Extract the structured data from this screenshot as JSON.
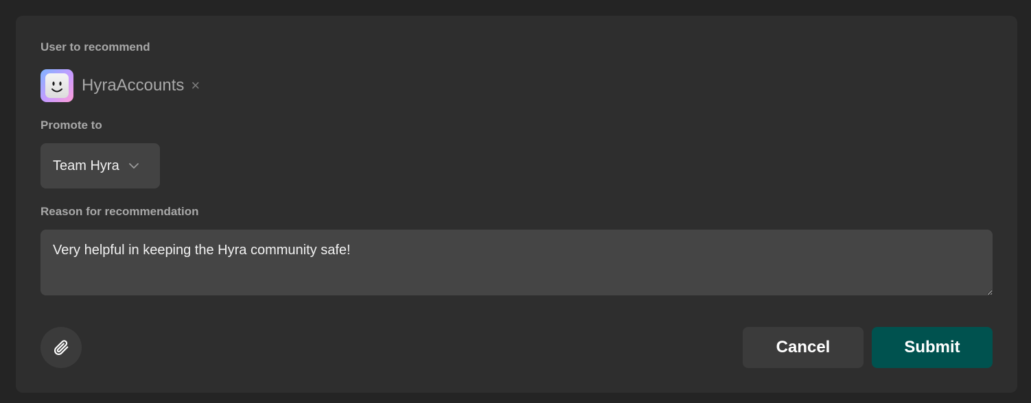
{
  "form": {
    "user_label": "User to recommend",
    "user": {
      "name": "HyraAccounts",
      "remove_glyph": "×",
      "avatar_icon": "roblox-avatar-icon"
    },
    "promote_label": "Promote to",
    "promote_value": "Team Hyra",
    "reason_label": "Reason for recommendation",
    "reason_value": "Very helpful in keeping the Hyra community safe!"
  },
  "actions": {
    "attach_icon": "paperclip-icon",
    "cancel_label": "Cancel",
    "submit_label": "Submit"
  },
  "colors": {
    "background": "#242424",
    "panel": "#2e2e2e",
    "input": "#454545",
    "submit": "#00524f",
    "cancel": "#3b3b3b"
  }
}
